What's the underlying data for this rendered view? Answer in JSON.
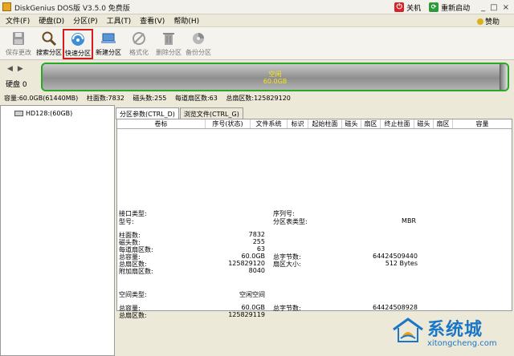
{
  "window": {
    "title": "DiskGenius DOS版 V3.5.0 免费版",
    "shutdown_label": "关机",
    "restart_label": "重新启动"
  },
  "menu": {
    "items": [
      "文件(F)",
      "硬盘(D)",
      "分区(P)",
      "工具(T)",
      "查看(V)",
      "帮助(H)"
    ],
    "help_link": "赞助"
  },
  "toolbar": {
    "buttons": [
      {
        "label": "保存更改",
        "icon": "save-icon"
      },
      {
        "label": "搜索分区",
        "icon": "search-icon"
      },
      {
        "label": "快速分区",
        "icon": "quick-partition-icon"
      },
      {
        "label": "新建分区",
        "icon": "new-partition-icon"
      },
      {
        "label": "格式化",
        "icon": "format-icon"
      },
      {
        "label": "删除分区",
        "icon": "delete-icon"
      },
      {
        "label": "备份分区",
        "icon": "backup-icon"
      }
    ]
  },
  "disk": {
    "label": "硬盘 0",
    "bar_label": "空闲",
    "bar_size": "60.0GB",
    "info": {
      "capacity": "容量:60.0GB(61440MB)",
      "cylinders": "柱面数:7832",
      "heads": "磁头数:255",
      "sectors_per_track": "每道扇区数:63",
      "total_sectors": "总扇区数:125829120"
    }
  },
  "tree": {
    "node": "HD128:(60GB)"
  },
  "tabs": {
    "partition_params": "分区参数(CTRL_D)",
    "browse_files": "浏览文件(CTRL_G)"
  },
  "table": {
    "columns": [
      "卷标",
      "序号(状态)",
      "文件系统",
      "标识",
      "起始柱面",
      "磁头",
      "扇区",
      "终止柱面",
      "磁头",
      "扇区",
      "容量"
    ]
  },
  "details": {
    "interface_type_label": "接口类型:",
    "model_label": "型号:",
    "serial_label": "序列号:",
    "partition_table_type_label": "分区表类型:",
    "partition_table_type_value": "MBR",
    "cylinders_label": "柱面数:",
    "cylinders_value": "7832",
    "heads_label": "磁头数:",
    "heads_value": "255",
    "sectors_per_track_label": "每道扇区数:",
    "sectors_per_track_value": "63",
    "total_capacity_label": "总容量:",
    "total_capacity_value": "60.0GB",
    "total_bytes_label": "总字节数:",
    "total_bytes_value": "64424509440",
    "total_sectors_label": "总扇区数:",
    "total_sectors_value": "125829120",
    "sector_size_label": "扇区大小:",
    "sector_size_value": "512 Bytes",
    "extra_sectors_label": "附加扇区数:",
    "extra_sectors_value": "8040",
    "space_type_label": "空间类型:",
    "space_type_value": "空闲空间",
    "free_capacity_label": "总容量:",
    "free_capacity_value": "60.0GB",
    "free_bytes_label": "总字节数:",
    "free_bytes_value": "64424508928",
    "free_sectors_label": "总扇区数:",
    "free_sectors_value": "125829119"
  },
  "watermark": {
    "text": "系统城",
    "url": "xitongcheng.com"
  }
}
